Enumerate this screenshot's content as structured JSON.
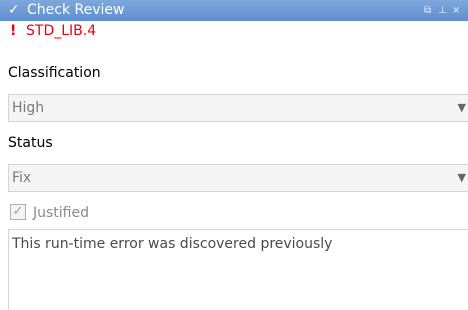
{
  "window": {
    "title": "Check Review",
    "controls": {
      "restore": "⧉",
      "pin": "←",
      "close": "×"
    }
  },
  "check": {
    "id": "STD_LIB.4"
  },
  "classification": {
    "label": "Classification",
    "value": "High"
  },
  "status": {
    "label": "Status",
    "value": "Fix"
  },
  "justified": {
    "label": "Justified",
    "checked": true
  },
  "comment": {
    "text": "This run-time error was discovered previously"
  },
  "colors": {
    "titlebar": "#6b98d6",
    "check_id": "#e8000f"
  }
}
